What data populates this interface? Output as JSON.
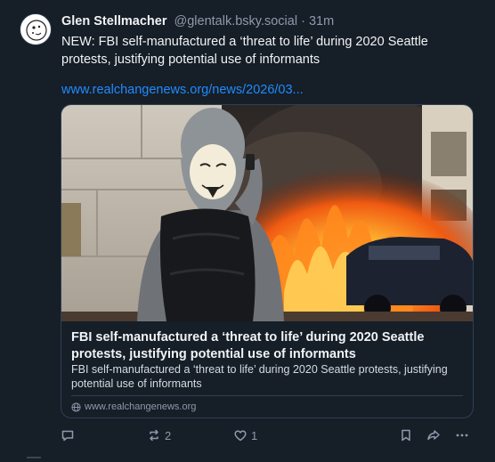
{
  "post": {
    "author_name": "Glen Stellmacher",
    "author_handle": "@glentalk.bsky.social",
    "separator": "·",
    "time": "31m",
    "text": "NEW: FBI self-manufactured a ‘threat to life’ during 2020 Seattle protests, justifying potential use of informants",
    "link_text": "www.realchangenews.org/news/2026/03..."
  },
  "card": {
    "title": "FBI self-manufactured a ‘threat to life’ during 2020 Seattle protests, justifying potential use of informants",
    "description": "FBI self-manufactured a ‘threat to life’ during 2020 Seattle protests, justifying potential use of informants",
    "domain": "www.realchangenews.org"
  },
  "actions": {
    "reply_count": "",
    "repost_count": "2",
    "like_count": "1"
  },
  "icons": {
    "reply": "reply-icon",
    "repost": "repost-icon",
    "like": "heart-icon",
    "bookmark": "bookmark-icon",
    "share": "share-icon",
    "more": "more-icon",
    "globe": "globe-icon"
  },
  "colors": {
    "background": "#161e27",
    "link": "#208bfe",
    "muted": "#8e9bac",
    "border": "#2e4052"
  }
}
